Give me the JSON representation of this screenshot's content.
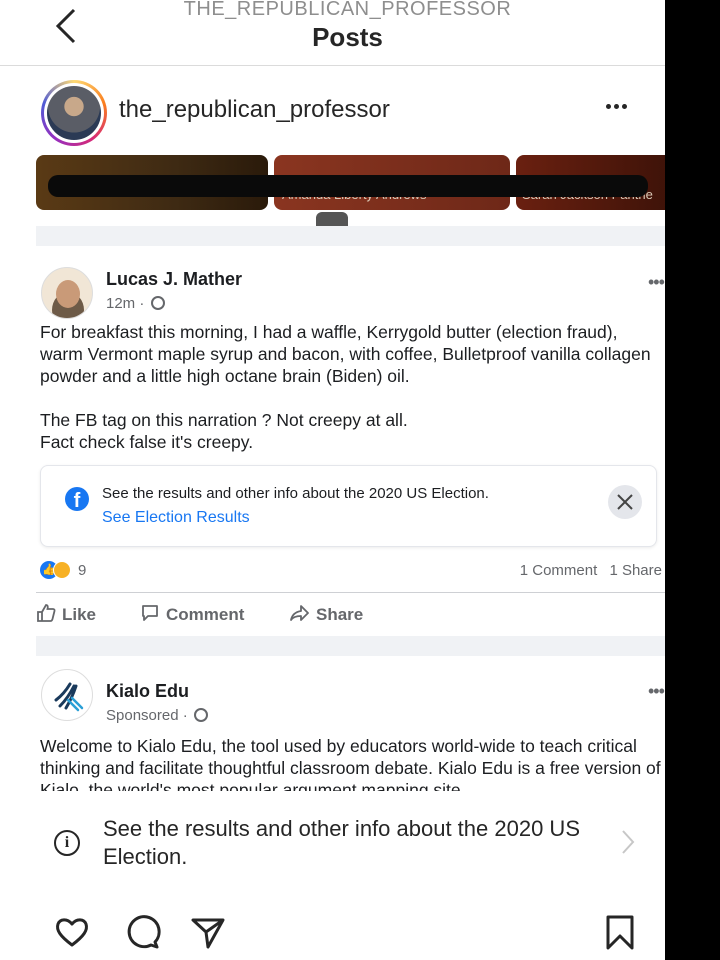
{
  "instagram": {
    "header_username": "THE_REPUBLICAN_PROFESSOR",
    "header_title": "Posts",
    "post_username": "the_republican_professor",
    "election_notice": "See the results and other info about the 2020 US Election."
  },
  "banner": {
    "items": [
      "Amanda Liberty Andrews",
      "Sarah Jackson Panthe"
    ]
  },
  "fb_post": {
    "author": "Lucas J. Mather",
    "time": "12m ·",
    "paragraph1": "For breakfast this morning, I had a waffle, Kerrygold butter (election fraud), warm Vermont maple syrup and bacon, with coffee, Bulletproof vanilla collagen powder and a little high octane brain (Biden) oil.",
    "paragraph2_line1": "The FB tag on this narration ? Not creepy at all.",
    "paragraph2_line2": "Fact check false it's creepy.",
    "election_box_text": "See the results and other info about the 2020 US Election.",
    "election_box_link": "See Election Results",
    "reaction_count": "9",
    "comments": "1 Comment",
    "shares": "1 Share",
    "like_label": "Like",
    "comment_label": "Comment",
    "share_label": "Share"
  },
  "sponsored_post": {
    "author": "Kialo Edu",
    "label": "Sponsored ·",
    "body": "Welcome to Kialo Edu, the tool used by educators world-wide to teach critical thinking and facilitate thoughtful classroom debate. Kialo Edu is a free version of Kialo, the world's most popular argument mapping site."
  },
  "colors": {
    "fb_blue": "#1877f2",
    "text_gray": "#65676b",
    "divider": "#f0f2f5"
  }
}
